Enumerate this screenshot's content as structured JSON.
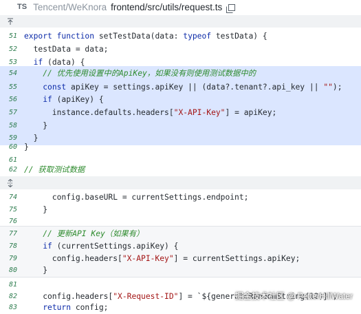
{
  "header": {
    "badge": "TS",
    "repo": "Tencent/WeKnora",
    "file_path": "frontend/src/utils/request.ts",
    "copy_icon": "copy-icon"
  },
  "expand_icons": [
    "expand-up-icon",
    "expand-both-icon"
  ],
  "code_lines": {
    "l51": {
      "no": "51",
      "a": "export function",
      "b": " setTestData(data: ",
      "c": "typeof",
      "d": " testData) {"
    },
    "l52": {
      "no": "52",
      "a": "  testData = data;"
    },
    "l53": {
      "no": "53",
      "a": "  ",
      "b": "if",
      "c": " (data) {"
    },
    "l54": {
      "no": "54",
      "a": "    // 优先使用设置中的ApiKey，如果没有则使用测试数据中的"
    },
    "l55": {
      "no": "55",
      "a": "    ",
      "b": "const",
      "c": " apiKey = settings.apiKey || (data?.tenant?.api_key || ",
      "d": "\"\"",
      "e": ");"
    },
    "l56": {
      "no": "56",
      "a": "    ",
      "b": "if",
      "c": " (apiKey) {"
    },
    "l57": {
      "no": "57",
      "a": "      instance.defaults.headers[",
      "b": "\"X-API-Key\"",
      "c": "] = apiKey;"
    },
    "l58": {
      "no": "58",
      "a": "    }"
    },
    "l59": {
      "no": "59",
      "a": "  }"
    },
    "l60": {
      "no": "60",
      "a": "}"
    },
    "l61": {
      "no": "61",
      "a": ""
    },
    "l62": {
      "no": "62",
      "a": "// 获取测试数据"
    },
    "l74": {
      "no": "74",
      "a": "      config.baseURL = currentSettings.endpoint;"
    },
    "l75": {
      "no": "75",
      "a": "    }"
    },
    "l76": {
      "no": "76",
      "a": ""
    },
    "l77": {
      "no": "77",
      "a": "    // 更新API Key（如果有）"
    },
    "l78": {
      "no": "78",
      "a": "    ",
      "b": "if",
      "c": " (currentSettings.apiKey) {"
    },
    "l79": {
      "no": "79",
      "a": "      config.headers[",
      "b": "\"X-API-Key\"",
      "c": "] = currentSettings.apiKey;"
    },
    "l80": {
      "no": "80",
      "a": "    }"
    },
    "l81": {
      "no": "81",
      "a": ""
    },
    "l82": {
      "no": "82",
      "a": "    config.headers[",
      "b": "\"X-Request-ID\"",
      "c": "] = `${generateRandomString(12)}`;"
    },
    "l83": {
      "no": "83",
      "a": "    ",
      "b": "return",
      "c": " config;"
    }
  },
  "watermark": "掘金技术社区 @ PetterHillWater",
  "colors": {
    "highlight_bg": "#dbe6ff",
    "context_bg": "#f6f7f9",
    "keyword": "#0b2aa8",
    "string": "#a31515",
    "comment": "#2e8b2e",
    "line_number": "#2e7d4f"
  }
}
